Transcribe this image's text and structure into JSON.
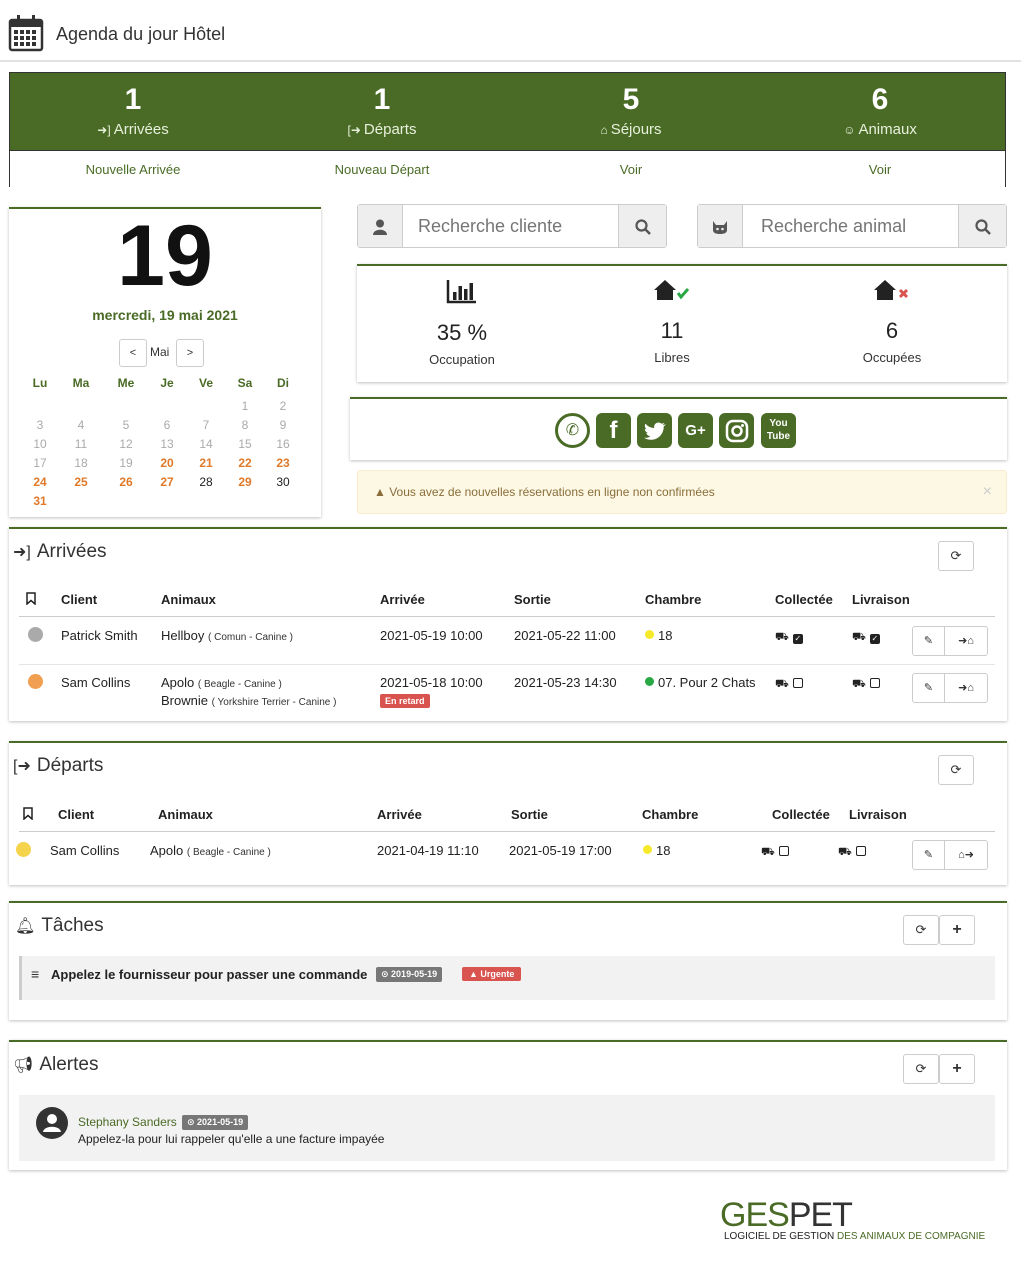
{
  "header": {
    "title": "Agenda du jour Hôtel"
  },
  "stats": [
    {
      "num": "1",
      "label": "Arrivées",
      "link": "Nouvelle Arrivée",
      "icon": "sign-in-icon"
    },
    {
      "num": "1",
      "label": "Départs",
      "link": "Nouveau Départ",
      "icon": "sign-out-icon"
    },
    {
      "num": "5",
      "label": "Séjours",
      "link": "Voir",
      "icon": "home-icon"
    },
    {
      "num": "6",
      "label": "Animaux",
      "link": "Voir",
      "icon": "cat-icon"
    }
  ],
  "date": {
    "day": "19",
    "full": "mercredi, 19 mai 2021",
    "month": "Mai",
    "prev": "<",
    "next": ">",
    "weekdays": [
      "Lu",
      "Ma",
      "Me",
      "Je",
      "Ve",
      "Sa",
      "Di"
    ],
    "weeks": [
      [
        "",
        "",
        "",
        "",
        "",
        "1",
        "2"
      ],
      [
        "3",
        "4",
        "5",
        "6",
        "7",
        "8",
        "9"
      ],
      [
        "10",
        "11",
        "12",
        "13",
        "14",
        "15",
        "16"
      ],
      [
        "17",
        "18",
        "19",
        "20",
        "21",
        "22",
        "23"
      ],
      [
        "24",
        "25",
        "26",
        "27",
        "28",
        "29",
        "30"
      ],
      [
        "31",
        "",
        "",
        "",
        "",
        "",
        ""
      ]
    ],
    "highlighted_days": [
      "20",
      "21",
      "22",
      "23",
      "24",
      "25",
      "26",
      "27",
      "29",
      "31"
    ]
  },
  "search": {
    "client_placeholder": "Recherche cliente",
    "animal_placeholder": "Recherche animal"
  },
  "occupancy": [
    {
      "value": "35 %",
      "caption": "Occupation"
    },
    {
      "value": "11",
      "caption": "Libres"
    },
    {
      "value": "6",
      "caption": "Occupées"
    }
  ],
  "social": [
    "whatsapp",
    "facebook",
    "twitter",
    "google-plus",
    "instagram",
    "youtube"
  ],
  "notice": {
    "text": "Vous avez de nouvelles réservations en ligne non confirmées",
    "close": "×"
  },
  "arrivals": {
    "title": "Arrivées",
    "headers": [
      "Client",
      "Animaux",
      "Arrivée",
      "Sortie",
      "Chambre",
      "Collectée",
      "Livraison"
    ],
    "rows": [
      {
        "status_color": "#aaaaaa",
        "client": "Patrick Smith",
        "animal1": "Hellboy",
        "animal1_detail": "( Comun - Canine )",
        "animal2": "",
        "animal2_detail": "",
        "arrival": "2021-05-19 10:00",
        "departure": "2021-05-22 11:00",
        "room": "18",
        "room_color": "#f5e92a",
        "late": "",
        "collected": true,
        "delivered": true
      },
      {
        "status_color": "#f0a050",
        "client": "Sam Collins",
        "animal1": "Apolo",
        "animal1_detail": "( Beagle - Canine )",
        "animal2": "Brownie",
        "animal2_detail": "( Yorkshire Terrier - Canine )",
        "arrival": "2021-05-18 10:00",
        "departure": "2021-05-23 14:30",
        "room": "07. Pour 2 Chats",
        "room_color": "#28a745",
        "late": "En retard",
        "collected": false,
        "delivered": false
      }
    ]
  },
  "departures": {
    "title": "Départs",
    "headers": [
      "Client",
      "Animaux",
      "Arrivée",
      "Sortie",
      "Chambre",
      "Collectée",
      "Livraison"
    ],
    "rows": [
      {
        "status_color": "#f5d34a",
        "client": "Sam Collins",
        "animal1": "Apolo",
        "animal1_detail": "( Beagle - Canine )",
        "arrival": "2021-04-19 11:10",
        "departure": "2021-05-19 17:00",
        "room": "18",
        "room_color": "#f5e92a",
        "collected": false,
        "delivered": false
      }
    ]
  },
  "tasks": {
    "title": "Tâches",
    "items": [
      {
        "text": "Appelez le fournisseur pour passer une commande",
        "date": "2019-05-19",
        "priority": "Urgente"
      }
    ]
  },
  "alerts": {
    "title": "Alertes",
    "items": [
      {
        "author": "Stephany Sanders",
        "date": "2021-05-19",
        "text": "Appelez-la pour lui rappeler qu'elle a une facture impayée"
      }
    ]
  },
  "logo": {
    "word_a": "GES",
    "word_b": "PET",
    "sub_a": "LOGICIEL DE GESTION ",
    "sub_b": "DES ANIMAUX DE COMPAGNIE"
  },
  "colors": {
    "brand": "#4a6b26",
    "late": "#d9534f",
    "highlight": "#e07a2a"
  }
}
